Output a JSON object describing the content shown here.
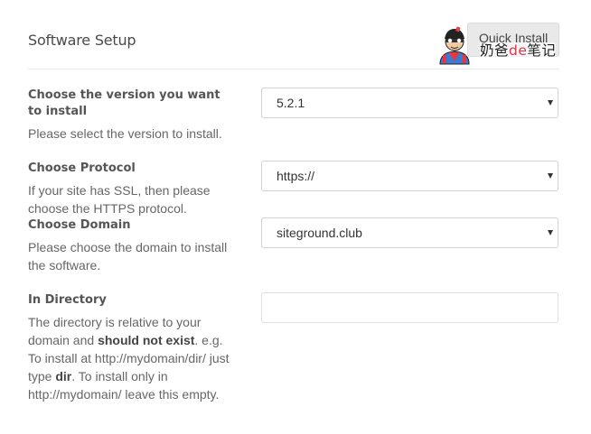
{
  "header": {
    "title": "Software Setup",
    "quick_install_label": "Quick Install"
  },
  "watermark": {
    "text_a": "奶爸",
    "text_b": "de",
    "text_c": "笔记"
  },
  "form": {
    "version": {
      "label": "Choose the version you want to install",
      "description": "Please select the version to install.",
      "selected": "5.2.1"
    },
    "protocol": {
      "label": "Choose Protocol",
      "description": "If your site has SSL, then please choose the HTTPS protocol.",
      "selected": "https://"
    },
    "domain": {
      "label": "Choose Domain",
      "description": "Please choose the domain to install the software.",
      "selected": "siteground.club"
    },
    "directory": {
      "label": "In Directory",
      "desc_1": "The directory is relative to your domain and ",
      "desc_bold_1": "should not exist",
      "desc_2": ". e.g. To install at http://mydomain/dir/ just type ",
      "desc_bold_2": "dir",
      "desc_3": ". To install only in http://mydomain/ leave this empty.",
      "value": ""
    }
  }
}
